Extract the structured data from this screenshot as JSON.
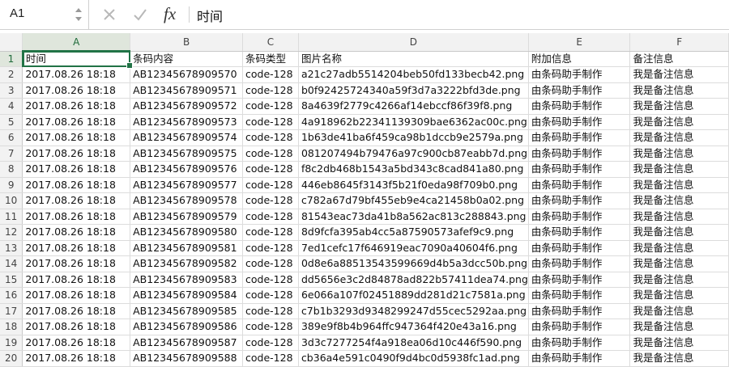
{
  "formula_bar": {
    "cell_ref": "A1",
    "fx_label": "fx",
    "content": "时间"
  },
  "columns": [
    "A",
    "B",
    "C",
    "D",
    "E",
    "F"
  ],
  "header_row": {
    "number": "1",
    "cells": [
      "时间",
      "条码内容",
      "条码类型",
      "图片名称",
      "附加信息",
      "备注信息"
    ]
  },
  "rows": [
    {
      "num": "2",
      "cells": [
        "2017.08.26 18:18",
        "AB12345678909570",
        "code-128",
        "a21c27adb5514204beb50fd133becb42.png",
        "由条码助手制作",
        "我是备注信息"
      ]
    },
    {
      "num": "3",
      "cells": [
        "2017.08.26 18:18",
        "AB12345678909571",
        "code-128",
        "b0f92425724340a59f3d7a3222bfd3de.png",
        "由条码助手制作",
        "我是备注信息"
      ]
    },
    {
      "num": "4",
      "cells": [
        "2017.08.26 18:18",
        "AB12345678909572",
        "code-128",
        "8a4639f2779c4266af14ebccf86f39f8.png",
        "由条码助手制作",
        "我是备注信息"
      ]
    },
    {
      "num": "5",
      "cells": [
        "2017.08.26 18:18",
        "AB12345678909573",
        "code-128",
        "4a918962b22341139309bae6362ac00c.png",
        "由条码助手制作",
        "我是备注信息"
      ]
    },
    {
      "num": "6",
      "cells": [
        "2017.08.26 18:18",
        "AB12345678909574",
        "code-128",
        "1b63de41ba6f459ca98b1dccb9e2579a.png",
        "由条码助手制作",
        "我是备注信息"
      ]
    },
    {
      "num": "7",
      "cells": [
        "2017.08.26 18:18",
        "AB12345678909575",
        "code-128",
        "081207494b79476a97c900cb87eabb7d.png",
        "由条码助手制作",
        "我是备注信息"
      ]
    },
    {
      "num": "8",
      "cells": [
        "2017.08.26 18:18",
        "AB12345678909576",
        "code-128",
        "f8c2db468b1543a5bd343c8cad841a80.png",
        "由条码助手制作",
        "我是备注信息"
      ]
    },
    {
      "num": "9",
      "cells": [
        "2017.08.26 18:18",
        "AB12345678909577",
        "code-128",
        "446eb8645f3143f5b21f0eda98f709b0.png",
        "由条码助手制作",
        "我是备注信息"
      ]
    },
    {
      "num": "10",
      "cells": [
        "2017.08.26 18:18",
        "AB12345678909578",
        "code-128",
        "c782a67d79bf455eb9e4ca21458b0a02.png",
        "由条码助手制作",
        "我是备注信息"
      ]
    },
    {
      "num": "11",
      "cells": [
        "2017.08.26 18:18",
        "AB12345678909579",
        "code-128",
        "81543eac73da41b8a562ac813c288843.png",
        "由条码助手制作",
        "我是备注信息"
      ]
    },
    {
      "num": "12",
      "cells": [
        "2017.08.26 18:18",
        "AB12345678909580",
        "code-128",
        "8d9fcfa395ab4cc5a87590573afef9c9.png",
        "由条码助手制作",
        "我是备注信息"
      ]
    },
    {
      "num": "13",
      "cells": [
        "2017.08.26 18:18",
        "AB12345678909581",
        "code-128",
        "7ed1cefc17f646919eac7090a40604f6.png",
        "由条码助手制作",
        "我是备注信息"
      ]
    },
    {
      "num": "14",
      "cells": [
        "2017.08.26 18:18",
        "AB12345678909582",
        "code-128",
        "0d8e6a88513543599669d4b5a3dcc50b.png",
        "由条码助手制作",
        "我是备注信息"
      ]
    },
    {
      "num": "15",
      "cells": [
        "2017.08.26 18:18",
        "AB12345678909583",
        "code-128",
        "dd5656e3c2d84878ad822b57411dea74.png",
        "由条码助手制作",
        "我是备注信息"
      ]
    },
    {
      "num": "16",
      "cells": [
        "2017.08.26 18:18",
        "AB12345678909584",
        "code-128",
        "6e066a107f02451889dd281d21c7581a.png",
        "由条码助手制作",
        "我是备注信息"
      ]
    },
    {
      "num": "17",
      "cells": [
        "2017.08.26 18:18",
        "AB12345678909585",
        "code-128",
        "c7b1b3293d9348299247d55cec5292aa.png",
        "由条码助手制作",
        "我是备注信息"
      ]
    },
    {
      "num": "18",
      "cells": [
        "2017.08.26 18:18",
        "AB12345678909586",
        "code-128",
        "389e9f8b4b964ffc947364f420e43a16.png",
        "由条码助手制作",
        "我是备注信息"
      ]
    },
    {
      "num": "19",
      "cells": [
        "2017.08.26 18:18",
        "AB12345678909587",
        "code-128",
        "3d3c7277254f4a918ea06d10c446f590.png",
        "由条码助手制作",
        "我是备注信息"
      ]
    },
    {
      "num": "20",
      "cells": [
        "2017.08.26 18:18",
        "AB12345678909588",
        "code-128",
        "cb36a4e591c0490f9d4bc0d5938fc1ad.png",
        "由条码助手制作",
        "我是备注信息"
      ]
    }
  ],
  "colors": {
    "selection": "#217346",
    "header_bg": "#f2f2f2",
    "gridline": "#dcdcdc"
  }
}
